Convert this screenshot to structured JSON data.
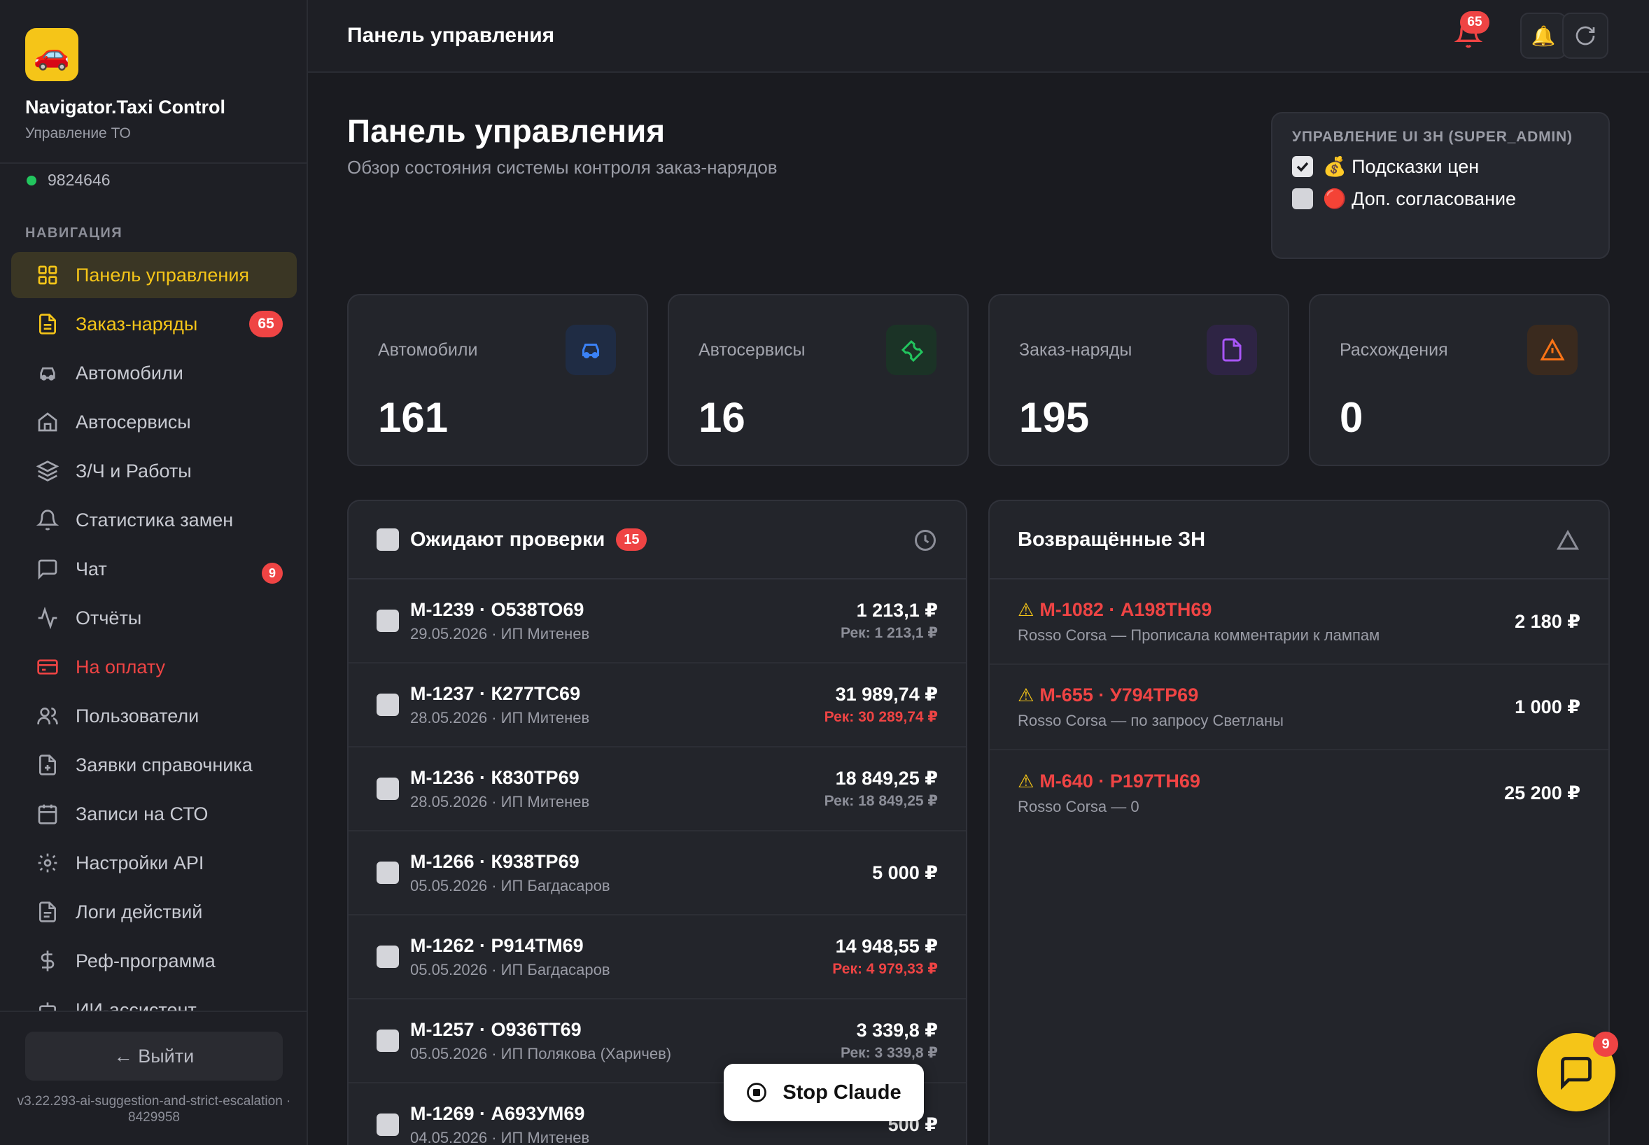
{
  "sidebar": {
    "app_name": "Navigator.Taxi Control",
    "app_subtitle": "Управление ТО",
    "user_id": "9824646",
    "nav_heading": "НАВИГАЦИЯ",
    "items": [
      {
        "label": "Панель управления",
        "icon": "dashboard-icon"
      },
      {
        "label": "Заказ-наряды",
        "icon": "document-icon",
        "badge": "65"
      },
      {
        "label": "Автомобили",
        "icon": "car-icon"
      },
      {
        "label": "Автосервисы",
        "icon": "building-icon"
      },
      {
        "label": "З/Ч и Работы",
        "icon": "layers-icon"
      },
      {
        "label": "Статистика замен",
        "icon": "bell-icon"
      },
      {
        "label": "Чат",
        "icon": "chat-icon",
        "badge": "9"
      },
      {
        "label": "Отчёты",
        "icon": "activity-icon"
      },
      {
        "label": "На оплату",
        "icon": "credit-card-icon"
      },
      {
        "label": "Пользователи",
        "icon": "users-icon"
      },
      {
        "label": "Заявки справочника",
        "icon": "file-plus-icon"
      },
      {
        "label": "Записи на СТО",
        "icon": "calendar-icon"
      },
      {
        "label": "Настройки API",
        "icon": "gear-icon"
      },
      {
        "label": "Логи действий",
        "icon": "log-icon"
      },
      {
        "label": "Реф-программа",
        "icon": "dollar-icon"
      },
      {
        "label": "ИИ-ассистент",
        "icon": "bot-icon"
      }
    ],
    "logout_label": "← Выйти",
    "version": "v3.22.293-ai-suggestion-and-strict-escalation · 8429958"
  },
  "topbar": {
    "title": "Панель управления",
    "notification_count": "65"
  },
  "main": {
    "title": "Панель управления",
    "subtitle": "Обзор состояния системы контроля заказ-нарядов"
  },
  "ui_panel": {
    "title": "УПРАВЛЕНИЕ UI ЗН (SUPER_ADMIN)",
    "options": [
      {
        "label": "💰 Подсказки цен",
        "checked": true
      },
      {
        "label": "🔴 Доп. согласование",
        "checked": false
      }
    ]
  },
  "stats": [
    {
      "label": "Автомобили",
      "value": "161",
      "icon": "car-icon",
      "color": "#3b82f6"
    },
    {
      "label": "Автосервисы",
      "value": "16",
      "icon": "wrench-icon",
      "color": "#22c55e"
    },
    {
      "label": "Заказ-наряды",
      "value": "195",
      "icon": "document-icon",
      "color": "#a855f7"
    },
    {
      "label": "Расхождения",
      "value": "0",
      "icon": "warning-icon",
      "color": "#f97316"
    }
  ],
  "pending": {
    "title": "Ожидают проверки",
    "count": "15",
    "rows": [
      {
        "title": "М-1239 · О538ТО69",
        "meta": "29.05.2026 · ИП Митенев",
        "amount": "1 213,1 ₽",
        "rec": "Рек: 1 213,1 ₽",
        "rec_alert": false
      },
      {
        "title": "М-1237 · К277ТС69",
        "meta": "28.05.2026 · ИП Митенев",
        "amount": "31 989,74 ₽",
        "rec": "Рек: 30 289,74 ₽",
        "rec_alert": true
      },
      {
        "title": "М-1236 · К830ТР69",
        "meta": "28.05.2026 · ИП Митенев",
        "amount": "18 849,25 ₽",
        "rec": "Рек: 18 849,25 ₽",
        "rec_alert": false
      },
      {
        "title": "М-1266 · К938ТР69",
        "meta": "05.05.2026 · ИП Багдасаров",
        "amount": "5 000 ₽",
        "rec": "",
        "rec_alert": false
      },
      {
        "title": "М-1262 · Р914ТМ69",
        "meta": "05.05.2026 · ИП Багдасаров",
        "amount": "14 948,55 ₽",
        "rec": "Рек: 4 979,33 ₽",
        "rec_alert": true
      },
      {
        "title": "М-1257 · О936ТТ69",
        "meta": "05.05.2026 · ИП Полякова (Харичев)",
        "amount": "3 339,8 ₽",
        "rec": "Рек: 3 339,8 ₽",
        "rec_alert": false
      },
      {
        "title": "М-1269 · А693УМ69",
        "meta": "04.05.2026 · ИП Митенев",
        "amount": "500 ₽",
        "rec": "",
        "rec_alert": false
      }
    ]
  },
  "returned": {
    "title": "Возвращённые ЗН",
    "rows": [
      {
        "title": "М-1082 · А198ТН69",
        "meta": "Rosso Corsa — Прописала комментарии к лампам",
        "amount": "2 180 ₽"
      },
      {
        "title": "М-655 · У794ТР69",
        "meta": "Rosso Corsa — по запросу Светланы",
        "amount": "1 000 ₽"
      },
      {
        "title": "М-640 · Р197ТН69",
        "meta": "Rosso Corsa — 0",
        "amount": "25 200 ₽"
      }
    ]
  },
  "stop_button": "Stop Claude",
  "chat_fab_badge": "9"
}
